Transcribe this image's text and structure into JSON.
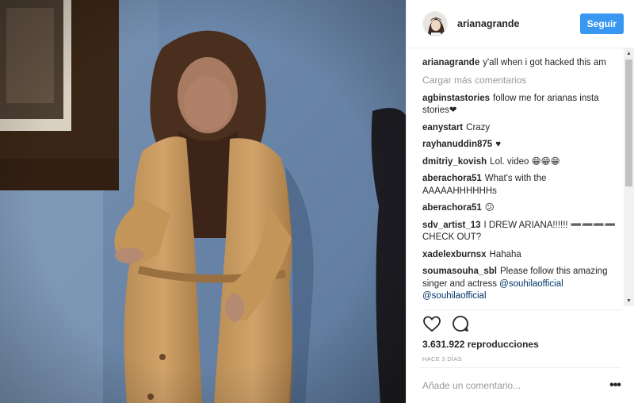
{
  "header": {
    "username": "arianagrande",
    "follow_label": "Seguir"
  },
  "caption": {
    "user": "arianagrande",
    "text": "y'all when i got hacked this am"
  },
  "load_more_label": "Cargar más comentarios",
  "comments": [
    {
      "user": "agbinstastories",
      "text": "follow me for arianas insta stories❤"
    },
    {
      "user": "eanystart",
      "text": "Crazy"
    },
    {
      "user": "rayhanuddin875",
      "text": "♥"
    },
    {
      "user": "dmitriy_kovish",
      "text": "Lol. video 😁😁😁"
    },
    {
      "user": "aberachora51",
      "text": "What's with the AAAAAHHHHHHs"
    },
    {
      "user": "aberachora51",
      "text": "😕"
    },
    {
      "user": "sdv_artist_13",
      "text": "I DREW ARIANA!!!!!! ➖➖➖➖ CHECK OUT?"
    },
    {
      "user": "xadelexburnsx",
      "text": "Hahaha"
    },
    {
      "user": "soumasouha_sbl",
      "text": "Please follow this amazing singer and actress",
      "mentions": "@souhilaofficial @souhilaofficial"
    }
  ],
  "stats": {
    "views": "3.631.922 reproducciones",
    "time_ago": "HACE 3 DÍAS"
  },
  "add_comment": {
    "placeholder": "Añade un comentario...",
    "more_label": "•••"
  },
  "icons": {
    "like": "heart-icon",
    "comment": "comment-bubble-icon"
  },
  "colors": {
    "accent": "#3897f0",
    "mention": "#003569",
    "muted": "#999999"
  }
}
